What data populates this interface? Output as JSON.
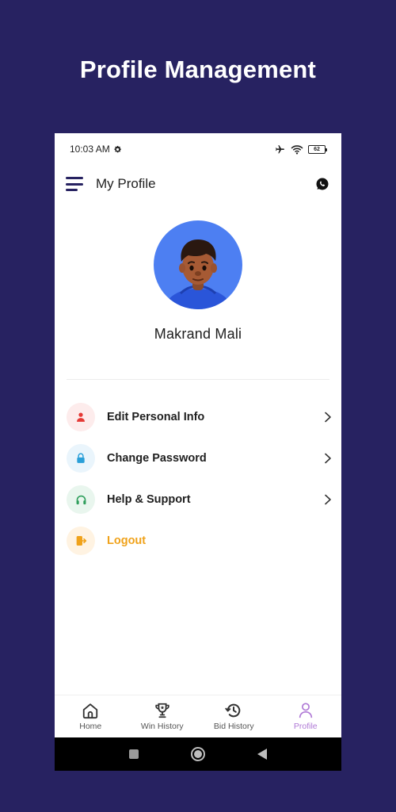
{
  "promo": {
    "title": "Profile Management"
  },
  "status_bar": {
    "time": "10:03 AM",
    "battery": "62"
  },
  "app_bar": {
    "title": "My Profile"
  },
  "profile": {
    "name": "Makrand Mali"
  },
  "menu": {
    "items": [
      {
        "label": "Edit Personal Info",
        "icon": "user-icon",
        "color": "#e53935",
        "bg": "#fdecec"
      },
      {
        "label": "Change Password",
        "icon": "lock-icon",
        "color": "#2a9fd8",
        "bg": "#eaf5fc"
      },
      {
        "label": "Help & Support",
        "icon": "headset-icon",
        "color": "#2e9e5b",
        "bg": "#e9f6ee"
      },
      {
        "label": "Logout",
        "icon": "logout-icon",
        "color": "#f0a21a",
        "bg": "#fff3e2"
      }
    ]
  },
  "bottom_nav": {
    "items": [
      {
        "label": "Home",
        "icon": "home-icon",
        "active": false
      },
      {
        "label": "Win History",
        "icon": "trophy-icon",
        "active": false
      },
      {
        "label": "Bid History",
        "icon": "history-icon",
        "active": false
      },
      {
        "label": "Profile",
        "icon": "profile-icon",
        "active": true
      }
    ]
  },
  "colors": {
    "background": "#272261",
    "accent": "#b07ad6",
    "avatar_bg": "#4d7ff2"
  }
}
